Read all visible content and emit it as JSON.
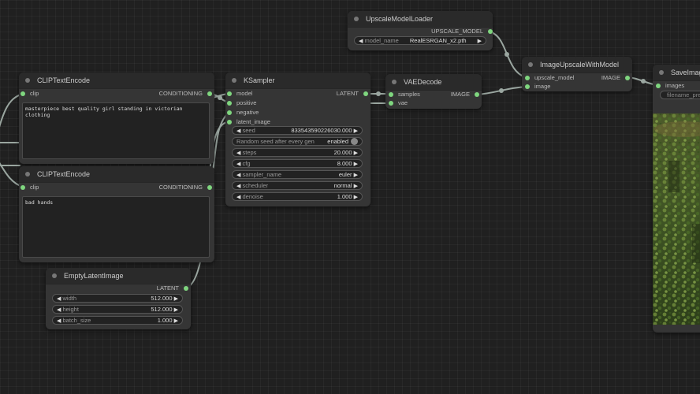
{
  "colors": {
    "canvas": "#202020",
    "node_body": "#353535",
    "node_title": "#2a2a2a",
    "link": "#9aa6a0",
    "pin": "#7fd67f"
  },
  "nodes": {
    "upscale_loader": {
      "title": "UpscaleModelLoader",
      "output": "UPSCALE_MODEL",
      "model_name_label": "model_name",
      "model_name_value": "RealESRGAN_x2.pth"
    },
    "image_upscale": {
      "title": "ImageUpscaleWithModel",
      "inputs": [
        "upscale_model",
        "image"
      ],
      "output": "IMAGE"
    },
    "save_image": {
      "title": "SaveImage",
      "input": "images",
      "filename_placeholder": "filename_pref"
    },
    "clip_positive": {
      "title": "CLIPTextEncode",
      "input": "clip",
      "output": "CONDITIONING",
      "text": "masterpiece best quality girl standing in victorian clothing"
    },
    "clip_negative": {
      "title": "CLIPTextEncode",
      "input": "clip",
      "output": "CONDITIONING",
      "text": "bad hands"
    },
    "ksampler": {
      "title": "KSampler",
      "inputs": [
        "model",
        "positive",
        "negative",
        "latent_image"
      ],
      "output": "LATENT",
      "widgets": {
        "seed_label": "seed",
        "seed_value": "833543590226030.000",
        "random_seed_label": "Random seed after every gen",
        "random_seed_value": "enabled",
        "steps_label": "steps",
        "steps_value": "20.000",
        "cfg_label": "cfg",
        "cfg_value": "8.000",
        "sampler_label": "sampler_name",
        "sampler_value": "euler",
        "scheduler_label": "scheduler",
        "scheduler_value": "normal",
        "denoise_label": "denoise",
        "denoise_value": "1.000"
      }
    },
    "vae_decode": {
      "title": "VAEDecode",
      "inputs": [
        "samples",
        "vae"
      ],
      "output": "IMAGE"
    },
    "empty_latent": {
      "title": "EmptyLatentImage",
      "output": "LATENT",
      "width_label": "width",
      "width_value": "512.000",
      "height_label": "height",
      "height_value": "512.000",
      "batch_label": "batch_size",
      "batch_value": "1.000"
    }
  }
}
